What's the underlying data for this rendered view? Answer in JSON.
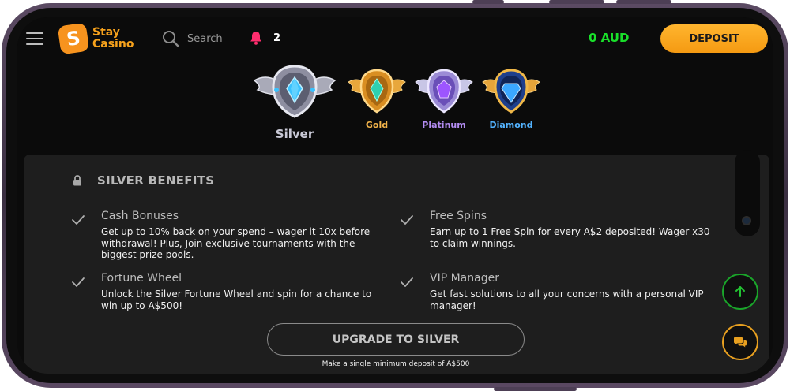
{
  "header": {
    "logo_line1": "Stay",
    "logo_line2": "Casino",
    "logo_letter": "S",
    "search_placeholder": "Search",
    "notification_count": "2",
    "balance": "0 AUD",
    "deposit_label": "DEPOSIT"
  },
  "tiers": [
    {
      "label": "Silver",
      "color": "#c9c9d6",
      "active": true
    },
    {
      "label": "Gold",
      "color": "#f2b34a",
      "active": false
    },
    {
      "label": "Platinum",
      "color": "#b38cf2",
      "active": false
    },
    {
      "label": "Diamond",
      "color": "#53b3ff",
      "active": false
    }
  ],
  "benefits": {
    "title": "SILVER BENEFITS",
    "items": [
      {
        "title": "Cash Bonuses",
        "desc": "Get up to 10% back on your spend – wager it 10x before withdrawal! Plus, Join exclusive tournaments with the biggest prize pools."
      },
      {
        "title": "Free Spins",
        "desc": "Earn up to 1 Free Spin for every A$2 deposited! Wager x30 to claim winnings."
      },
      {
        "title": "Fortune Wheel",
        "desc": "Unlock the Silver Fortune Wheel and spin for a chance to win up to A$500!"
      },
      {
        "title": "VIP Manager",
        "desc": "Get fast solutions to all your concerns with a personal VIP manager!"
      }
    ],
    "upgrade_label": "UPGRADE TO SILVER",
    "upgrade_note": "Make a single minimum deposit of A$500"
  },
  "colors": {
    "accent": "#f7931e",
    "balance": "#19e02a",
    "bell": "#ff2d6e"
  }
}
